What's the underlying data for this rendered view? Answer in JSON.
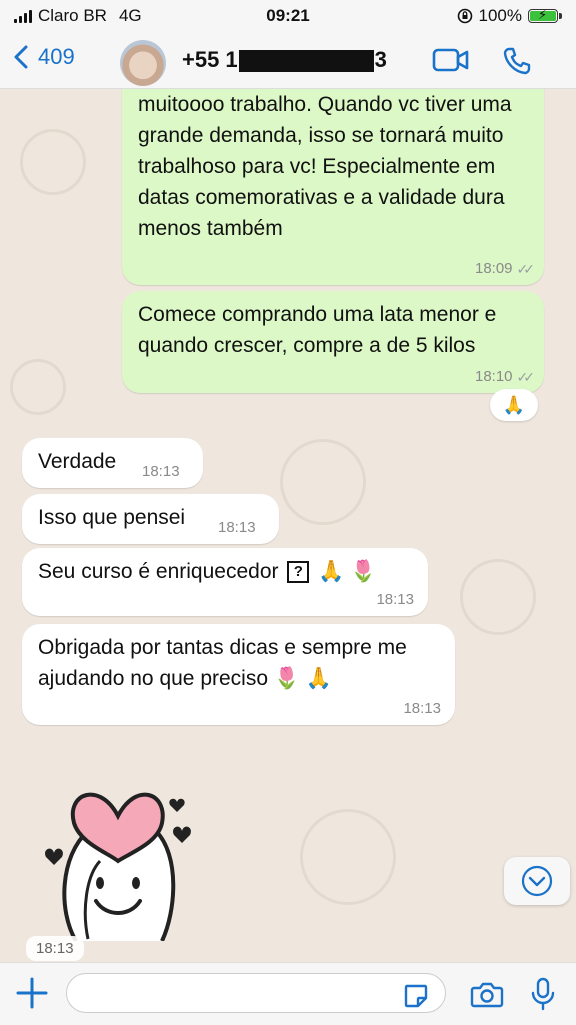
{
  "status_bar": {
    "carrier": "Claro BR",
    "network": "4G",
    "time": "09:21",
    "battery": "100%",
    "battery_level": 1.0
  },
  "header": {
    "back_count": "409",
    "contact_prefix": "+55 1",
    "contact_suffix": "3"
  },
  "messages": [
    {
      "direction": "out",
      "text": "muitoooo trabalho. Quando vc tiver uma grande demanda, isso se tornará muito trabalhoso para vc! Especialmente em datas comemorativas e a validade dura menos também",
      "time": "18:09"
    },
    {
      "direction": "out",
      "text": "Comece comprando uma lata menor e quando crescer, compre a de 5 kilos",
      "time": "18:10",
      "reaction": "🙏"
    },
    {
      "direction": "in",
      "text": "Verdade",
      "time": "18:13"
    },
    {
      "direction": "in",
      "text": "Isso que pensei",
      "time": "18:13"
    },
    {
      "direction": "in",
      "text": "Seu curso é enriquecedor",
      "emoji": "🙏 🌷",
      "time": "18:13"
    },
    {
      "direction": "in",
      "text": "Obrigada por tantas dicas e sempre me ajudando no que preciso",
      "emoji": "🌷 🙏",
      "time": "18:13"
    }
  ],
  "sticker": {
    "time": "18:13",
    "icon": "heart-character-sticker"
  },
  "colors": {
    "outgoing": "#dcf8c6",
    "incoming": "#ffffff",
    "accent": "#1a72c9",
    "background": "#efe7de"
  },
  "input": {
    "placeholder": ""
  }
}
